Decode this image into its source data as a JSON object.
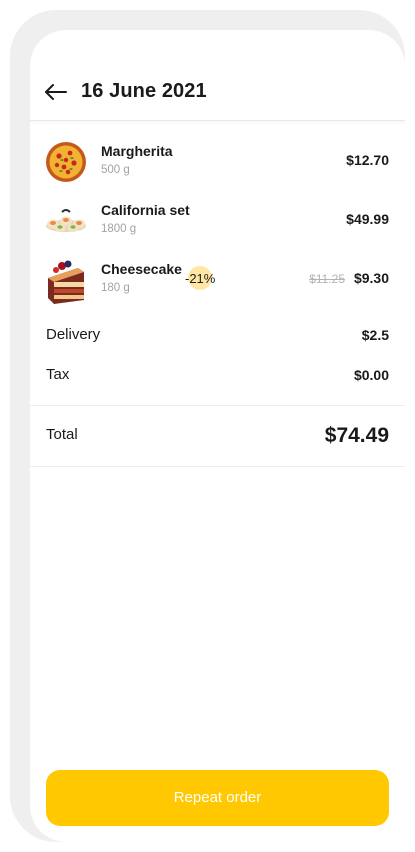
{
  "header": {
    "title": "16 June 2021"
  },
  "items": [
    {
      "name": "Margherita",
      "weight": "500 g",
      "price": "$12.70",
      "icon": "pizza-icon"
    },
    {
      "name": "California set",
      "weight": "1800 g",
      "price": "$49.99",
      "icon": "sushi-icon"
    },
    {
      "name": "Cheesecake",
      "weight": "180 g",
      "discount": "-21%",
      "old_price": "$11.25",
      "price": "$9.30",
      "icon": "cheesecake-icon"
    }
  ],
  "summary": {
    "delivery_label": "Delivery",
    "delivery_value": "$2.5",
    "tax_label": "Tax",
    "tax_value": "$0.00",
    "total_label": "Total",
    "total_value": "$74.49"
  },
  "actions": {
    "repeat_label": "Repeat order"
  },
  "colors": {
    "accent": "#ffc800",
    "discount_badge": "#ffe7a3",
    "muted_text": "#a3a3a3"
  }
}
